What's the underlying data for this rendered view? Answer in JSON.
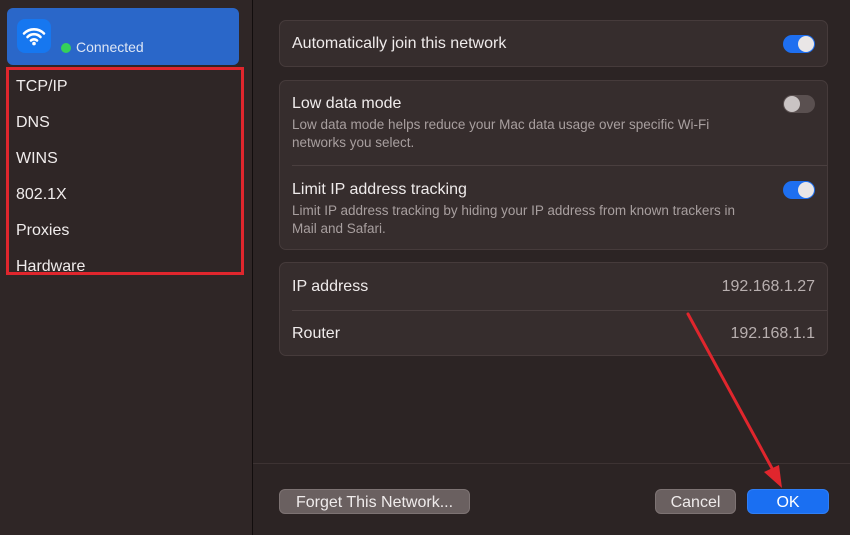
{
  "network": {
    "status": "Connected",
    "icon": "wifi-icon",
    "status_color": "#35d05a"
  },
  "sidebar": {
    "items": [
      {
        "label": "TCP/IP"
      },
      {
        "label": "DNS"
      },
      {
        "label": "WINS"
      },
      {
        "label": "802.1X"
      },
      {
        "label": "Proxies"
      },
      {
        "label": "Hardware"
      }
    ]
  },
  "settings": {
    "auto_join": {
      "title": "Automatically join this network",
      "enabled": true
    },
    "low_data": {
      "title": "Low data mode",
      "description": "Low data mode helps reduce your Mac data usage over specific Wi-Fi networks you select.",
      "enabled": false
    },
    "limit_ip": {
      "title": "Limit IP address tracking",
      "description": "Limit IP address tracking by hiding your IP address from known trackers in Mail and Safari.",
      "enabled": true
    }
  },
  "info": {
    "ip_label": "IP address",
    "ip_value": "192.168.1.27",
    "router_label": "Router",
    "router_value": "192.168.1.1"
  },
  "footer": {
    "forget_label": "Forget This Network...",
    "cancel_label": "Cancel",
    "ok_label": "OK"
  },
  "colors": {
    "accent": "#1a6ff2",
    "highlight": "#e0262d"
  }
}
